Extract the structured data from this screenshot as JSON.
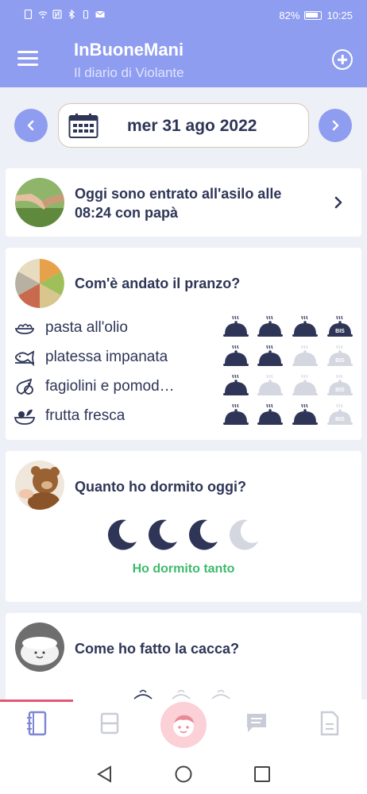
{
  "status_bar": {
    "battery": "82%",
    "time": "10:25"
  },
  "app_bar": {
    "title": "InBuoneMani",
    "subtitle": "Il diario di Violante"
  },
  "date_nav": {
    "date": "mer 31 ago 2022"
  },
  "arrival": {
    "text": "Oggi sono entrato all'asilo alle 08:24 con papà"
  },
  "lunch": {
    "title": "Com'è andato il pranzo?",
    "items": [
      {
        "label": "pasta all'olio",
        "icon": "spaghetti-icon",
        "portions_filled": 3,
        "extra_serving": true
      },
      {
        "label": "platessa impanata",
        "icon": "fish-icon",
        "portions_filled": 2,
        "extra_serving": false
      },
      {
        "label": "fagiolini e pomod…",
        "icon": "vegetables-icon",
        "portions_filled": 1,
        "extra_serving": false
      },
      {
        "label": "frutta fresca",
        "icon": "fruit-bowl-icon",
        "portions_filled": 3,
        "extra_serving": false
      }
    ],
    "extra_label": "BIS"
  },
  "sleep": {
    "title": "Quanto ho dormito oggi?",
    "moons_filled": 3,
    "moons_total": 4,
    "status": "Ho dormito tanto"
  },
  "poop": {
    "title": "Come ho fatto la cacca?"
  },
  "bottom_nav": {
    "tabs": [
      "diary-icon",
      "calendar-icon",
      "child-face-icon",
      "chat-icon",
      "document-icon"
    ],
    "active": "diary-icon"
  },
  "colors": {
    "primary": "#8f9df0",
    "dark": "#2e3557",
    "green": "#3db96b",
    "accent": "#e5566f"
  }
}
